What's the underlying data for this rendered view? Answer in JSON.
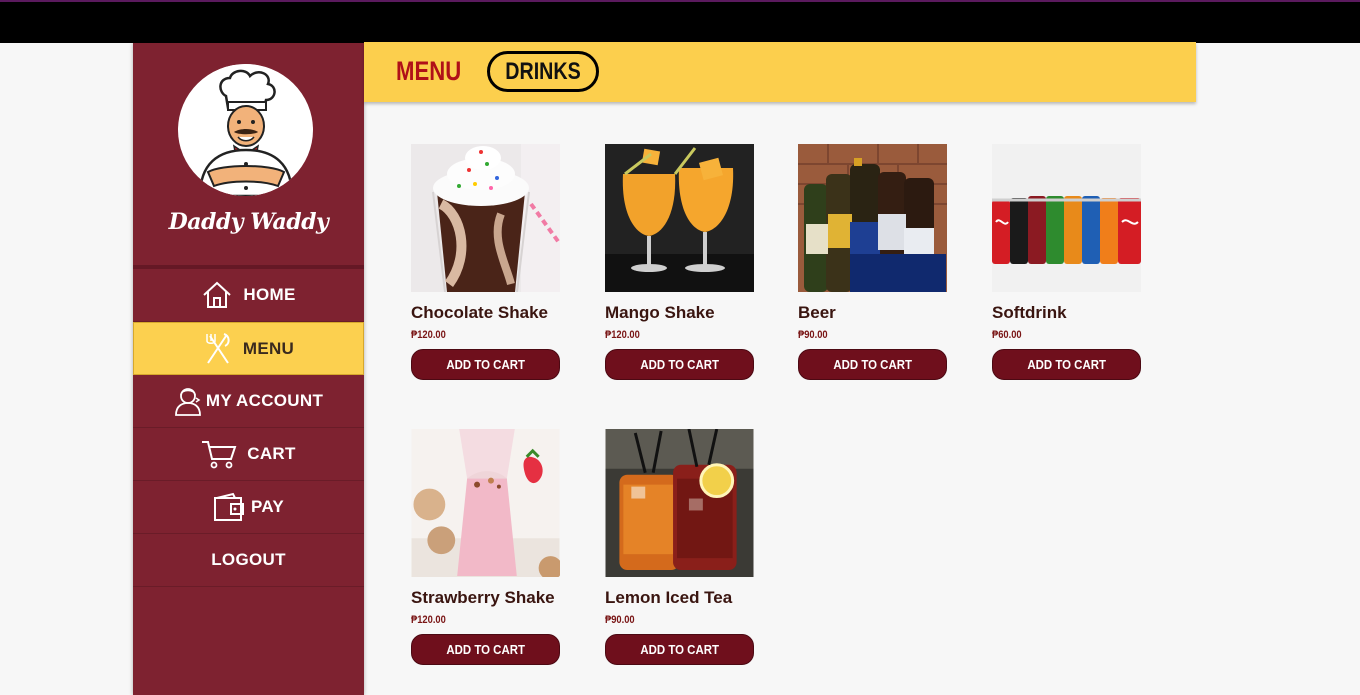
{
  "brand": {
    "name": "Daddy Waddy",
    "logo_icon": "chef-mascot-logo"
  },
  "nav": [
    {
      "label": "HOME",
      "icon": "home-icon"
    },
    {
      "label": "MENU",
      "icon": "utensils-icon",
      "active": true
    },
    {
      "label": "MY ACCOUNT",
      "icon": "user-icon"
    },
    {
      "label": "CART",
      "icon": "cart-icon"
    },
    {
      "label": "PAY",
      "icon": "wallet-icon"
    },
    {
      "label": "LOGOUT",
      "icon": ""
    }
  ],
  "header": {
    "title": "MENU",
    "category": "DRINKS"
  },
  "products": [
    {
      "name": "Chocolate Shake",
      "price": "₱120.00",
      "button": "ADD TO CART"
    },
    {
      "name": "Mango Shake",
      "price": "₱120.00",
      "button": "ADD TO CART"
    },
    {
      "name": "Beer",
      "price": "₱90.00",
      "button": "ADD TO CART"
    },
    {
      "name": "Softdrink",
      "price": "₱60.00",
      "button": "ADD TO CART"
    },
    {
      "name": "Strawberry Shake",
      "price": "₱120.00",
      "button": "ADD TO CART"
    },
    {
      "name": "Lemon Iced Tea",
      "price": "₱90.00",
      "button": "ADD TO CART"
    }
  ],
  "colors": {
    "sidebar": "#7e2230",
    "accent": "#fccf4d",
    "button": "#6f0f1c",
    "title_red": "#b01018"
  }
}
